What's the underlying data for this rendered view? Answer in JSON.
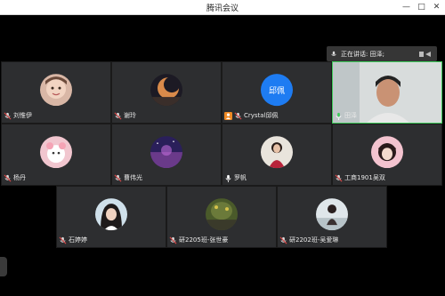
{
  "window": {
    "title": "腾讯会议",
    "min_label": "—",
    "max_label": "□",
    "close_label": "✕"
  },
  "speaking": {
    "label": "正在讲话: 田泽;"
  },
  "participants": [
    {
      "name": "刘惟伊",
      "mic": "muted",
      "avatar_text": ""
    },
    {
      "name": "谢玲",
      "mic": "muted",
      "avatar_text": ""
    },
    {
      "name": "Crystal邱佩",
      "mic": "host",
      "avatar_text": "邱佩"
    },
    {
      "name": "田泽",
      "mic": "active",
      "avatar_text": ""
    },
    {
      "name": "杨丹",
      "mic": "muted",
      "avatar_text": ""
    },
    {
      "name": "曹伟光",
      "mic": "muted",
      "avatar_text": ""
    },
    {
      "name": "罗帆",
      "mic": "active",
      "avatar_text": ""
    },
    {
      "name": "工商1901吴双",
      "mic": "muted",
      "avatar_text": ""
    },
    {
      "name": "石婷婷",
      "mic": "muted",
      "avatar_text": ""
    },
    {
      "name": "研2205班-张世豪",
      "mic": "muted",
      "avatar_text": ""
    },
    {
      "name": "研2202班-吴爱琳",
      "mic": "muted",
      "avatar_text": ""
    }
  ],
  "colors": {
    "tile_bg": "#2d2e30",
    "host_badge": "#f08a24",
    "active_mic": "#3ecb5b",
    "avatar_blue": "#1e7cf2"
  }
}
